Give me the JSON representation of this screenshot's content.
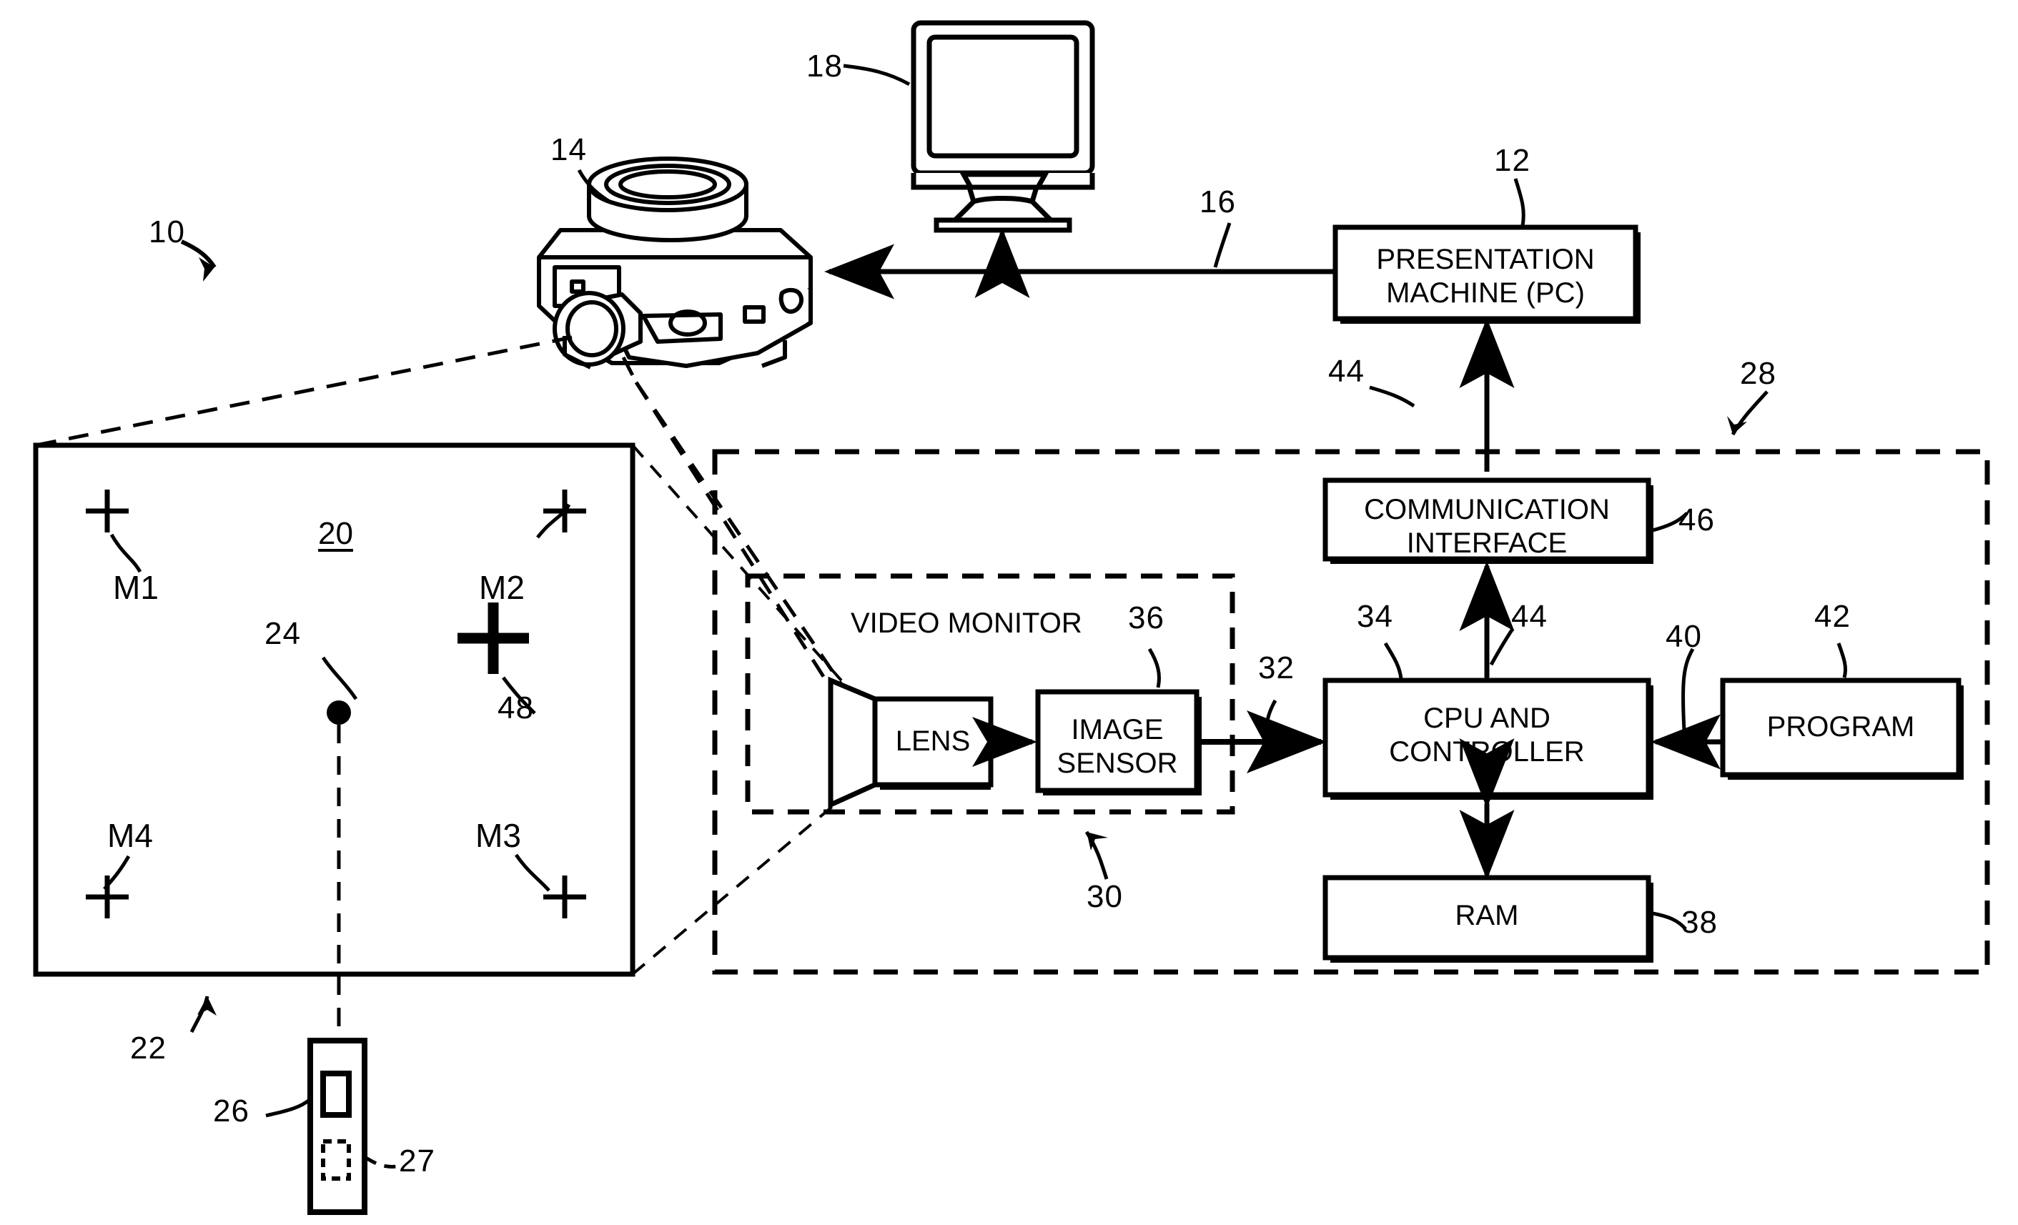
{
  "figure": {
    "title": "System block diagram with camera, presentation machine and marked screen",
    "line_color": "#000000",
    "background": "#ffffff"
  },
  "reference_numerals": {
    "system": "10",
    "presentation_machine": "12",
    "camera": "14",
    "camera_pc_link": "16",
    "display_monitor": "18",
    "screen_area": "20",
    "screen_border": "22",
    "pointer_spot": "24",
    "pointing_device": "26",
    "pointing_device_button": "27",
    "camera_unit_enclosure": "28",
    "video_monitor_block": "30",
    "image_sensor_output": "32",
    "cpu_input": "34",
    "image_sensor": "36",
    "ram": "38",
    "program_input": "40",
    "program": "42",
    "comm_link": "44",
    "communication_interface": "46",
    "large_marker": "48"
  },
  "boxes": {
    "presentation_machine": {
      "line1": "PRESENTATION",
      "line2": "MACHINE (PC)"
    },
    "communication_interface": {
      "line1": "COMMUNICATION",
      "line2": "INTERFACE"
    },
    "cpu_controller": {
      "line1": "CPU AND",
      "line2": "CONTROLLER"
    },
    "image_sensor": {
      "line1": "IMAGE",
      "line2": "SENSOR"
    },
    "lens": {
      "line1": "LENS"
    },
    "ram": {
      "line1": "RAM"
    },
    "program": {
      "line1": "PROGRAM"
    }
  },
  "labels": {
    "video_monitor": "VIDEO MONITOR"
  },
  "screen": {
    "area_label": "20",
    "markers": [
      {
        "name": "M1",
        "label": "M1",
        "size": "small"
      },
      {
        "name": "M2",
        "label": "M2",
        "size": "small"
      },
      {
        "name": "M3",
        "label": "M3",
        "size": "small"
      },
      {
        "name": "M4",
        "label": "M4",
        "size": "small"
      },
      {
        "name": "48",
        "label": "48",
        "size": "large"
      }
    ]
  }
}
